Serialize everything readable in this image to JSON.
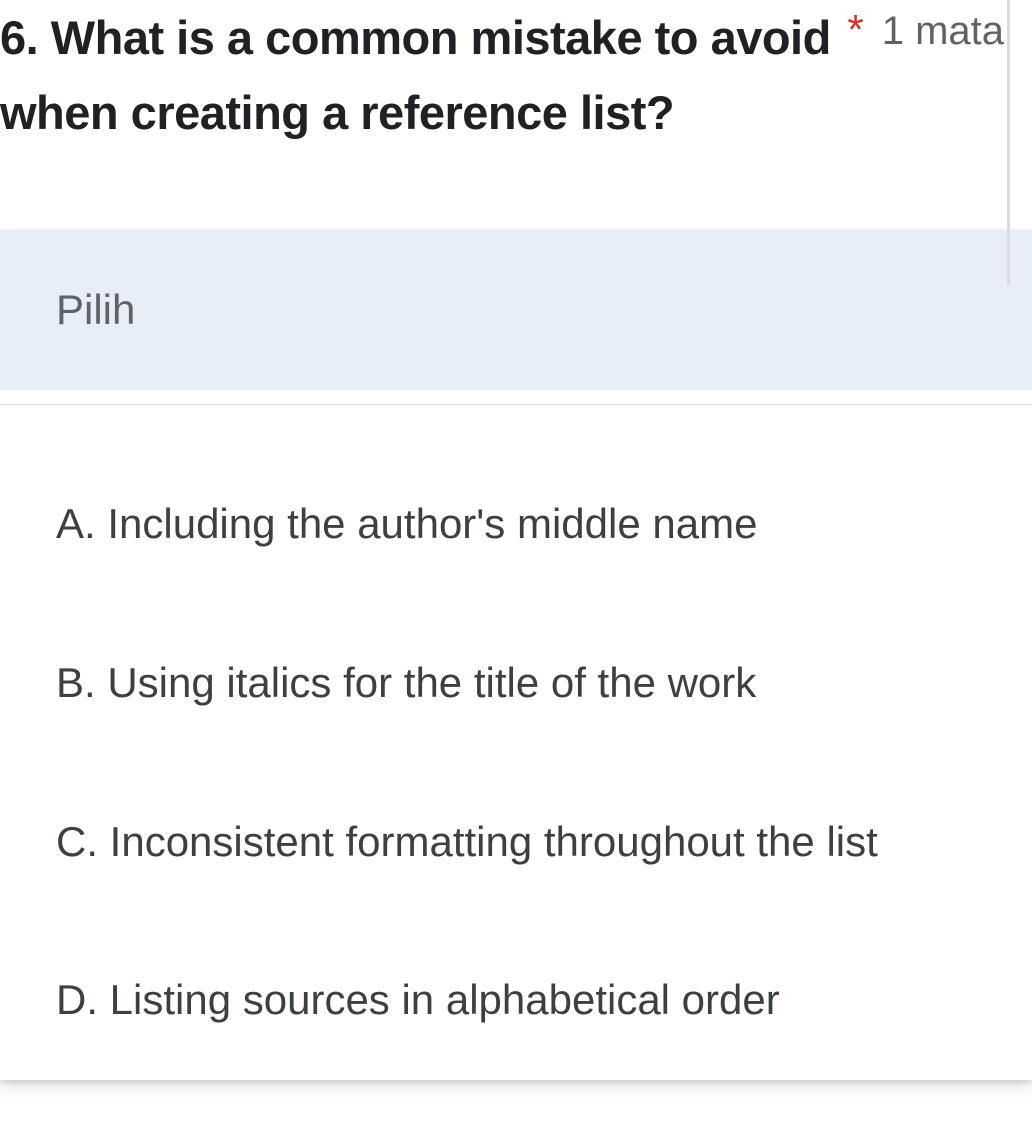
{
  "question": {
    "number": "6.",
    "text": "6. What is a common mistake to avoid when creating a reference list?",
    "required_marker": "*",
    "points_label": "1 mata"
  },
  "dropdown": {
    "placeholder": "Pilih",
    "options": [
      "A. Including the author's middle name",
      "B. Using italics for the title of the work",
      "C. Inconsistent formatting throughout the list",
      "D. Listing sources in alphabetical order"
    ]
  }
}
